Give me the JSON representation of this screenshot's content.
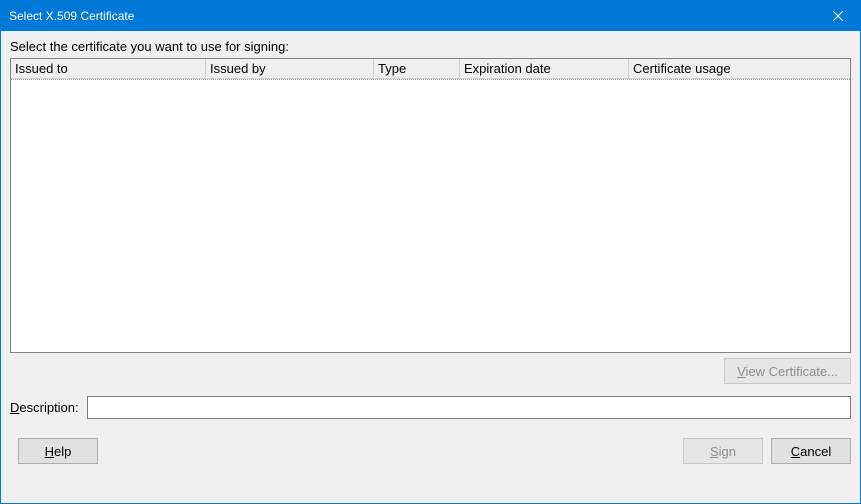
{
  "window": {
    "title": "Select X.509 Certificate"
  },
  "instruction": "Select the certificate you want to use for signing:",
  "columns": {
    "issued_to": "Issued to",
    "issued_by": "Issued by",
    "type": "Type",
    "expiration": "Expiration date",
    "usage": "Certificate usage"
  },
  "rows": [],
  "buttons": {
    "view_certificate_prefix": "V",
    "view_certificate_rest": "iew Certificate...",
    "help_prefix": "H",
    "help_rest": "elp",
    "sign_prefix": "S",
    "sign_rest": "ign",
    "cancel_prefix": "C",
    "cancel_rest": "ancel"
  },
  "description": {
    "label_prefix": "D",
    "label_rest": "escription:",
    "value": ""
  }
}
